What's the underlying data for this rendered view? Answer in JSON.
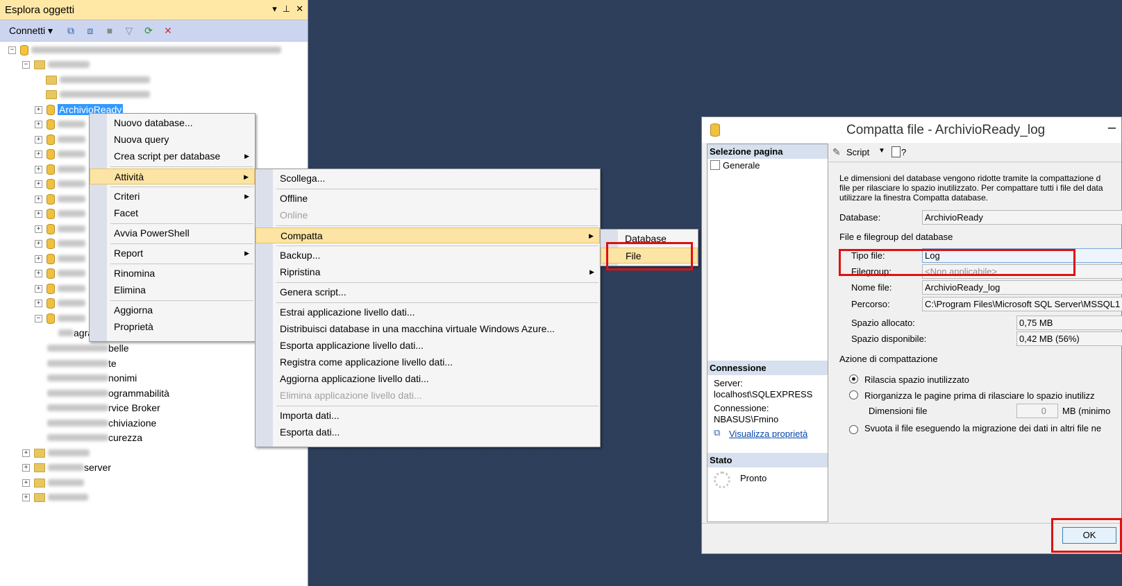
{
  "object_explorer": {
    "title": "Esplora oggetti",
    "title_buttons": [
      "▾",
      "⊥",
      "✕"
    ],
    "toolbar": {
      "connect_label": "Connetti ▾"
    },
    "selected_db": "ArchivioReady",
    "visible_items": {
      "diagrams": "agrammi database",
      "tables": "belle",
      "views": "te",
      "synonyms": "nonimi",
      "programmability": "ogrammabilità",
      "service_broker": "rvice Broker",
      "storage": "chiviazione",
      "security": "curezza",
      "server_objects": "server"
    }
  },
  "context_menu": {
    "items": [
      "Nuovo database...",
      "Nuova query",
      "Crea script per database",
      "Attività",
      "Criteri",
      "Facet",
      "Avvia PowerShell",
      "Report",
      "Rinomina",
      "Elimina",
      "Aggiorna",
      "Proprietà"
    ]
  },
  "tasks_menu": {
    "items": [
      "Scollega...",
      "Offline",
      "Online",
      "Compatta",
      "Backup...",
      "Ripristina",
      "Genera script...",
      "Estrai applicazione livello dati...",
      "Distribuisci database in una macchina virtuale Windows Azure...",
      "Esporta applicazione livello dati...",
      "Registra come applicazione livello dati...",
      "Aggiorna applicazione livello dati...",
      "Elimina applicazione livello dati...",
      "Importa dati...",
      "Esporta dati..."
    ]
  },
  "shrink_menu": {
    "items": [
      "Database",
      "File"
    ]
  },
  "dialog": {
    "title": "Compatta file - ArchivioReady_log",
    "minimize": "–",
    "select_page_header": "Selezione pagina",
    "page_general": "Generale",
    "connection_header": "Connessione",
    "server_label": "Server:",
    "server_value": "localhost\\SQLEXPRESS",
    "connection_label": "Connessione:",
    "connection_value": "NBASUS\\Fmino",
    "view_properties": "Visualizza proprietà",
    "status_header": "Stato",
    "status_value": "Pronto",
    "script_label": "Script",
    "help_label": "?",
    "description": [
      "Le dimensioni del database vengono ridotte tramite la compattazione d",
      "file per rilasciare lo spazio inutilizzato. Per compattare tutti i file del data",
      "utilizzare la finestra Compatta database."
    ],
    "database_label": "Database:",
    "database_value": "ArchivioReady",
    "file_group_section": "File e filegroup del database",
    "file_type_label": "Tipo file:",
    "file_type_value": "Log",
    "filegroup_label": "Filegroup:",
    "filegroup_value": "<Non applicabile>",
    "file_name_label": "Nome file:",
    "file_name_value": "ArchivioReady_log",
    "path_label": "Percorso:",
    "path_value": "C:\\Program Files\\Microsoft SQL Server\\MSSQL1",
    "allocated_label": "Spazio allocato:",
    "allocated_value": "0,75 MB",
    "available_label": "Spazio disponibile:",
    "available_value": "0,42 MB (56%)",
    "shrink_action_section": "Azione di compattazione",
    "opt_release": "Rilascia spazio inutilizzato",
    "opt_reorganize": "Riorganizza le pagine prima di rilasciare lo spazio inutilizz",
    "file_size_label": "Dimensioni file",
    "file_size_value": "0",
    "file_size_unit": "MB (minimo",
    "opt_empty": "Svuota il file eseguendo la migrazione dei dati in altri file ne",
    "ok_label": "OK"
  }
}
